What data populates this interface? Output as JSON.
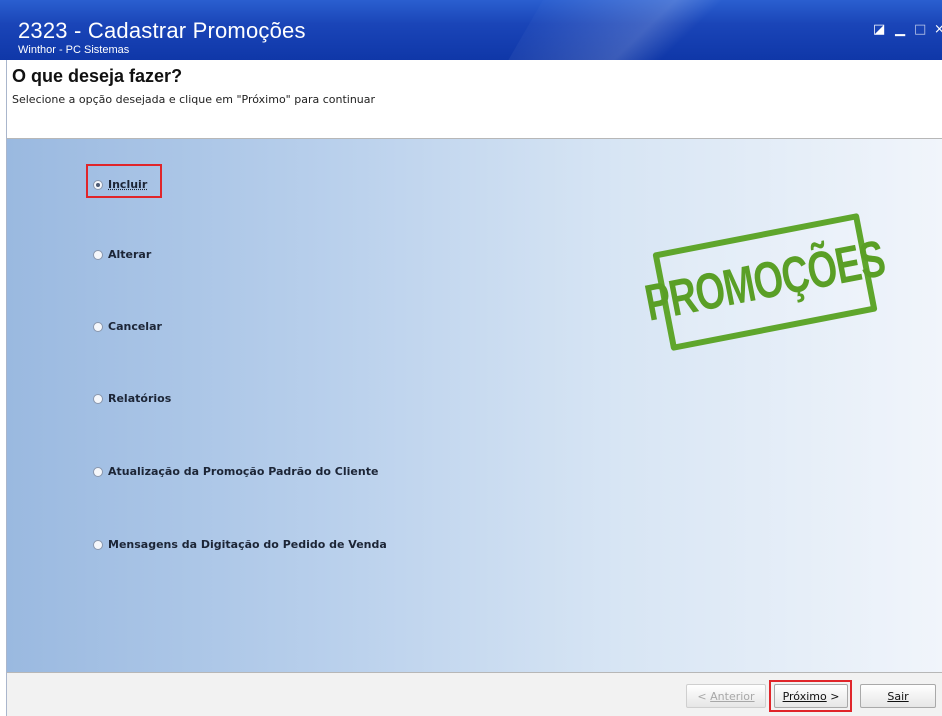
{
  "window": {
    "title": "2323 - Cadastrar Promoções",
    "subtitle": "Winthor - PC Sistemas",
    "controls": [
      "restore-icon",
      "minimize-icon",
      "maximize-icon",
      "close-icon"
    ]
  },
  "header": {
    "title": "O que deseja fazer?",
    "instruction": "Selecione a opção desejada e clique em \"Próximo\" para continuar"
  },
  "options": {
    "selected": "Incluir",
    "items": [
      {
        "label": "Incluir",
        "checked": true
      },
      {
        "label": "Alterar",
        "checked": false
      },
      {
        "label": "Cancelar",
        "checked": false
      },
      {
        "label": "Relatórios",
        "checked": false
      },
      {
        "label": "Atualização da Promoção Padrão do Cliente",
        "checked": false
      },
      {
        "label": "Mensagens da Digitação do Pedido de Venda",
        "checked": false
      }
    ]
  },
  "stamp": {
    "text": "PROMOÇÕES",
    "color": "#5fa62c"
  },
  "footer": {
    "prev_prefix": "< ",
    "prev_label": "Anterior",
    "next_label": "Próximo",
    "next_suffix": " >",
    "exit_label": "Sair",
    "prev_enabled": false
  },
  "colors": {
    "titlebar": "#1a45b8",
    "highlight": "#e0252a",
    "panel_start": "#9ab9e0",
    "panel_end": "#f1f5fb"
  }
}
